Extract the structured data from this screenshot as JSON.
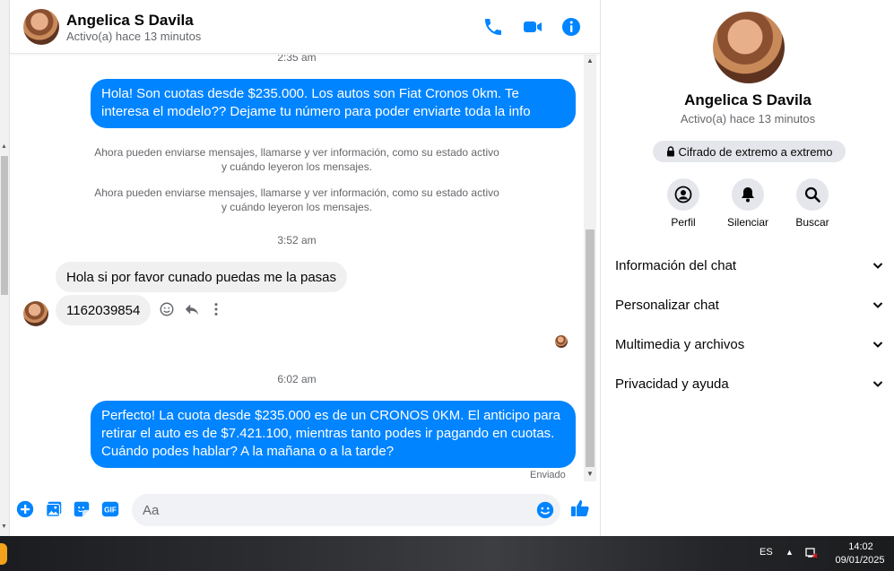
{
  "contact": {
    "name": "Angelica S Davila",
    "status": "Activo(a) hace 13 minutos"
  },
  "messages": {
    "ts1": "2:35 am",
    "out1": "Hola! Son cuotas desde $235.000. Los autos son Fiat Cronos 0km. Te interesa el modelo?? Dejame tu número para poder enviarte toda la info",
    "sys1": "Ahora pueden enviarse mensajes, llamarse y ver información, como su estado activo y cuándo leyeron los mensajes.",
    "sys2": "Ahora pueden enviarse mensajes, llamarse y ver información, como su estado activo y cuándo leyeron los mensajes.",
    "ts2": "3:52 am",
    "in1": "Hola si por favor cunado puedas me la pasas",
    "in2": "1162039854",
    "ts3": "6:02 am",
    "out2": "Perfecto! La cuota desde $235.000 es de un CRONOS 0KM. El anticipo para retirar el auto es de $7.421.100, mientras tanto podes ir pagando en cuotas. Cuándo podes hablar? A la mañana o a la tarde?",
    "sent_status": "Enviado"
  },
  "composer": {
    "placeholder": "Aa"
  },
  "panel": {
    "e2e": "Cifrado de extremo a extremo",
    "actions": [
      "Perfil",
      "Silenciar",
      "Buscar"
    ],
    "sections": [
      "Información del chat",
      "Personalizar chat",
      "Multimedia y archivos",
      "Privacidad y ayuda"
    ]
  },
  "taskbar": {
    "lang": "ES",
    "time": "14:02",
    "date": "09/01/2025"
  },
  "colors": {
    "accent": "#0084ff",
    "incoming_bubble": "#f0f0f0"
  }
}
